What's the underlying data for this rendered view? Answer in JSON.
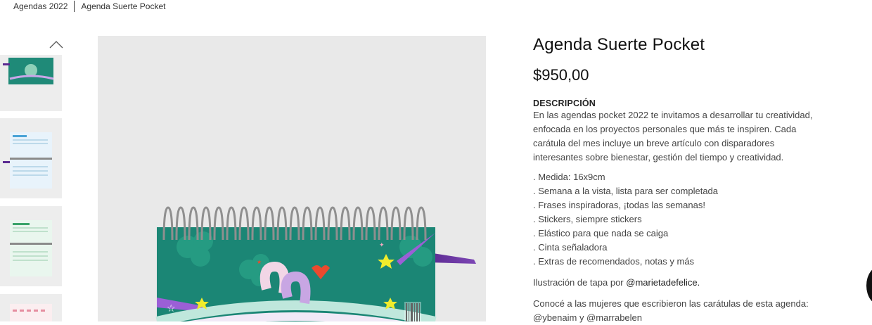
{
  "breadcrumb": {
    "parent": "Agendas 2022",
    "current": "Agenda Suerte Pocket"
  },
  "product": {
    "title": "Agenda Suerte Pocket",
    "price": "$950,00",
    "description_heading": "DESCRIPCIÓN",
    "description_lines": [
      "En las agendas pocket 2022 te invitamos a desarrollar tu creatividad,",
      "enfocada en los proyectos personales que más te inspiren. Cada",
      "carátula del mes incluye un breve artículo con disparadores",
      "interesantes sobre bienestar, gestión del tiempo y creatividad."
    ],
    "features": [
      ". Medida: 16x9cm",
      ". Semana a la vista, lista para ser completada",
      ". Frases inspiradoras, ¡todas las semanas!",
      ". Stickers, siempre stickers",
      ". Elástico para que nada se caiga",
      ". Cinta señaladora",
      ". Extras de recomendados, notas y más"
    ],
    "illustration_text": "Ilustración de tapa por ",
    "illustrator": "@marietadefelice.",
    "authors_text": "Conocé a las mujeres que escribieron las carátulas de esta agenda:",
    "authors_line": "@ybenaim y @marrabelen"
  },
  "icons": {
    "thumb_up": "chevron-up-icon",
    "chat": "chat-icon"
  },
  "colors": {
    "cover_teal": "#1f8a78",
    "ribbon_purple": "#5b2a91",
    "thumb_bg": "#ededed",
    "image_bg": "#e9e9e9"
  }
}
